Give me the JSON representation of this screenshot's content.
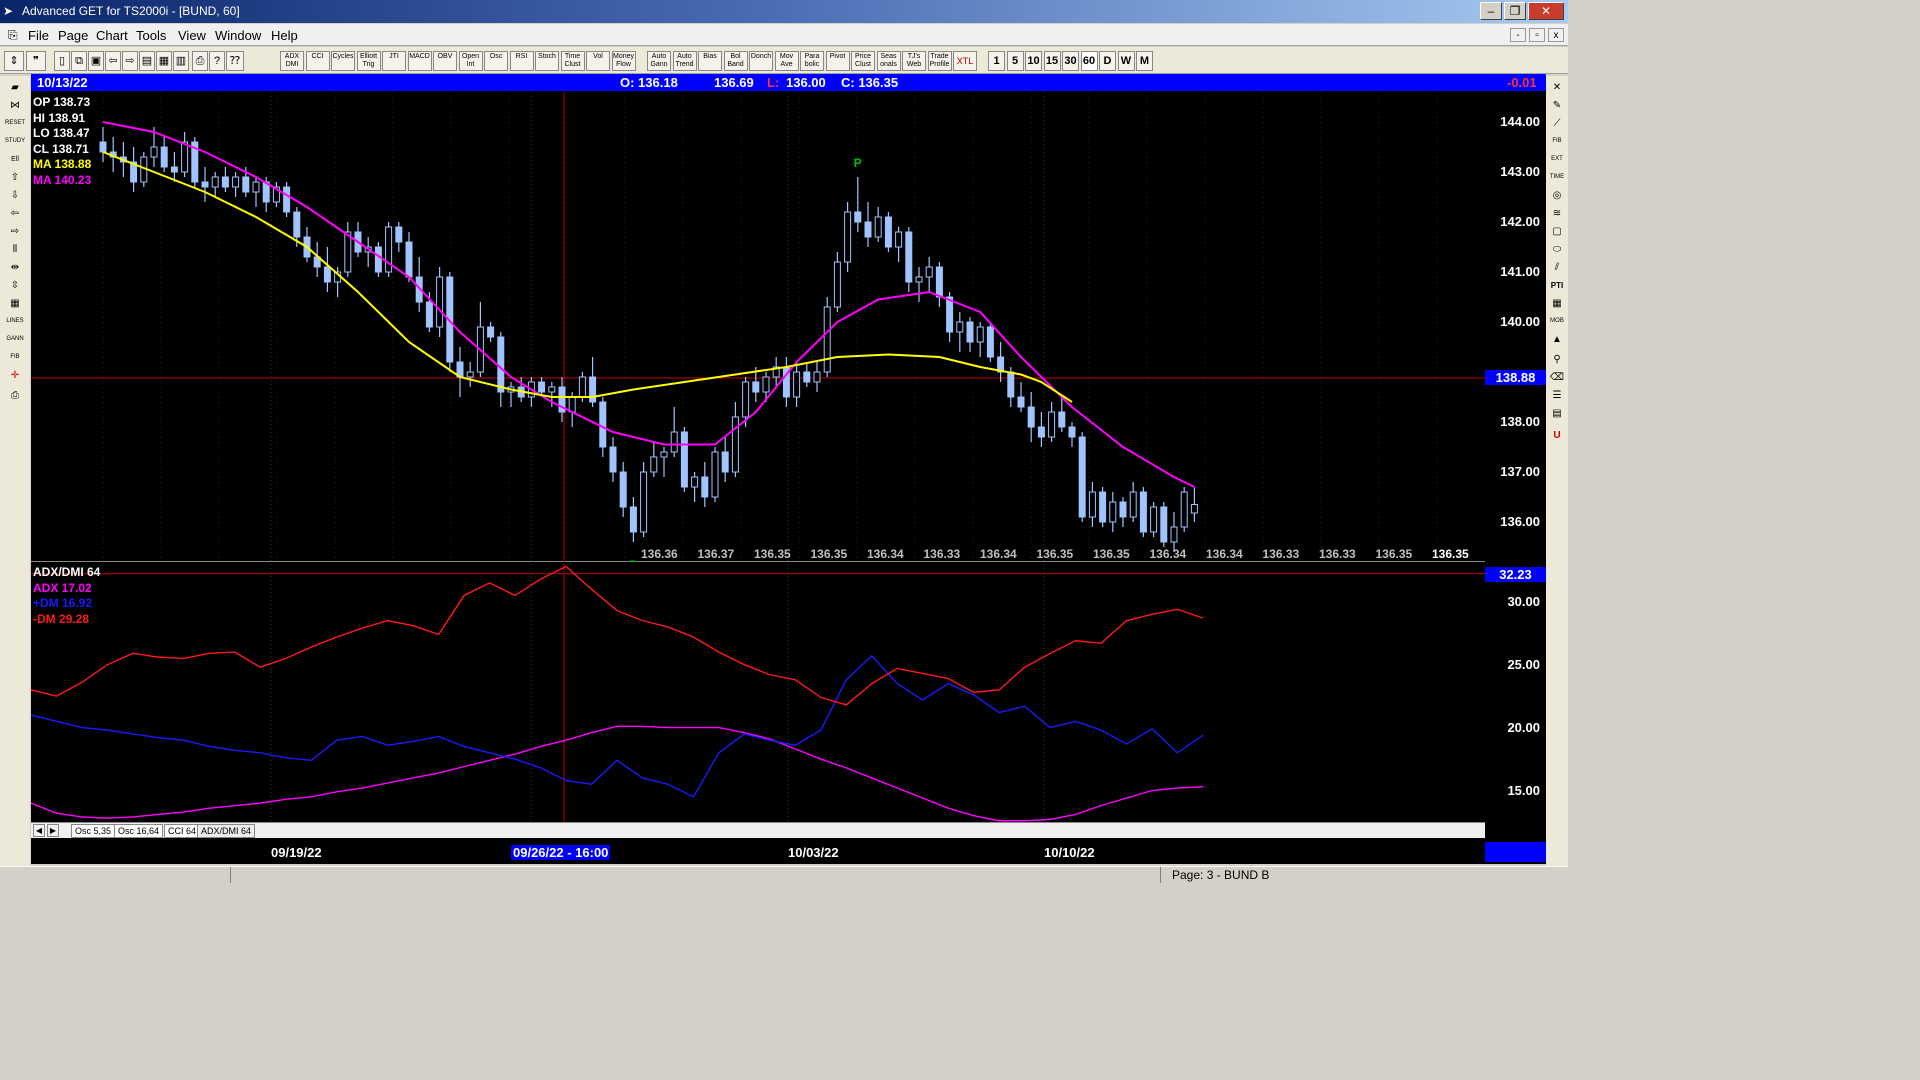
{
  "window": {
    "title": "Advanced GET for TS2000i - [BUND, 60]",
    "minimize": "‒",
    "maximize": "❐",
    "close": "✕"
  },
  "menu": [
    "File",
    "Page",
    "Chart",
    "Tools",
    "View",
    "Window",
    "Help"
  ],
  "mdi_buttons": [
    "-",
    "▫",
    "x"
  ],
  "toolbar": {
    "indicators": [
      "ADX DMI",
      "CCI",
      "Cycles",
      "Elliott Trig",
      "JTI",
      "MACD",
      "OBV",
      "Open Int",
      "Osc",
      "RSI",
      "Stoch",
      "Time Clust",
      "Vol",
      "Money Flow",
      "Auto Gann",
      "Auto Trend",
      "Bias",
      "Bol Band",
      "Donch",
      "Mov Ave",
      "Para bolic",
      "Pivot",
      "Price Clust",
      "Seas onals",
      "TJ's Web",
      "Trade Profile",
      "XTL"
    ],
    "periods": [
      "1",
      "5",
      "10",
      "15",
      "30",
      "60",
      "D",
      "W",
      "M"
    ],
    "selected_period": "60"
  },
  "info_bar": {
    "date": "10/13/22",
    "open": "O: 136.18",
    "high": "136.69",
    "low_label": "L:",
    "low": "136.00",
    "close": "C: 136.35",
    "change": "-0.01"
  },
  "price_labels": [
    {
      "text": "OP  138.73",
      "color": "#ffffff"
    },
    {
      "text": "HI   138.91",
      "color": "#ffffff"
    },
    {
      "text": "LO  138.47",
      "color": "#ffffff"
    },
    {
      "text": "CL  138.71",
      "color": "#ffffff"
    },
    {
      "text": "MA  138.88",
      "color": "#ffff00"
    },
    {
      "text": "MA  140.23",
      "color": "#ff00ff"
    }
  ],
  "osc_labels": [
    {
      "text": "ADX/DMI 64",
      "color": "#ffffff"
    },
    {
      "text": "ADX 17.02",
      "color": "#ff00ff"
    },
    {
      "text": "+DM 16.92",
      "color": "#1a1aff"
    },
    {
      "text": "-DM  29.28",
      "color": "#ff1a1a"
    }
  ],
  "price_axis_ticks": [
    "144.00",
    "143.00",
    "142.00",
    "141.00",
    "140.00",
    "138.00",
    "137.00",
    "136.00"
  ],
  "price_marker": "138.88",
  "osc_axis_ticks": [
    "30.00",
    "25.00",
    "20.00",
    "15.00"
  ],
  "osc_marker": "32.23",
  "bottom_values": [
    "136.36",
    "136.37",
    "136.35",
    "136.35",
    "136.34",
    "136.33",
    "136.34",
    "136.35",
    "136.35",
    "136.34",
    "136.34",
    "136.33",
    "136.33",
    "136.35",
    "136.35"
  ],
  "pivot_marks": [
    "P",
    "P"
  ],
  "tabs": [
    "Osc 5,35",
    "Osc 16,64",
    "CCI 64",
    "ADX/DMI 64"
  ],
  "active_tab": "ADX/DMI 64",
  "dates": [
    "09/19/22",
    "09/26/22 - 16:00",
    "10/03/22",
    "10/10/22"
  ],
  "status": "Page: 3 - BUND B",
  "colors": {
    "ma_fast": "#ffff00",
    "ma_slow": "#ff00ff",
    "adx": "#ff00ff",
    "plus_dm": "#1a1aff",
    "minus_dm": "#ff1a1a",
    "bars": "#a0c4ff",
    "crosshair": "#c00000"
  },
  "chart_data": [
    {
      "type": "candlestick",
      "title": "BUND, 60",
      "ylim": [
        135.2,
        144.6
      ],
      "ma_fast_path": [
        [
          0,
          143.4
        ],
        [
          5,
          143.0
        ],
        [
          10,
          142.6
        ],
        [
          15,
          142.1
        ],
        [
          20,
          141.5
        ],
        [
          25,
          140.6
        ],
        [
          30,
          139.6
        ],
        [
          35,
          138.9
        ],
        [
          40,
          138.65
        ],
        [
          44,
          138.5
        ],
        [
          48,
          138.5
        ],
        [
          52,
          138.65
        ],
        [
          57,
          138.8
        ],
        [
          62,
          138.95
        ],
        [
          67,
          139.1
        ],
        [
          72,
          139.3
        ],
        [
          77,
          139.35
        ],
        [
          82,
          139.3
        ],
        [
          86,
          139.1
        ],
        [
          90,
          138.95
        ],
        [
          92,
          138.8
        ],
        [
          95,
          138.4
        ]
      ],
      "ma_slow_path": [
        [
          0,
          144.0
        ],
        [
          5,
          143.8
        ],
        [
          10,
          143.4
        ],
        [
          15,
          142.9
        ],
        [
          20,
          142.3
        ],
        [
          25,
          141.6
        ],
        [
          30,
          140.9
        ],
        [
          35,
          139.8
        ],
        [
          40,
          138.9
        ],
        [
          44,
          138.4
        ],
        [
          50,
          137.8
        ],
        [
          55,
          137.55
        ],
        [
          60,
          137.55
        ],
        [
          64,
          138.2
        ],
        [
          68,
          139.2
        ],
        [
          72,
          140.0
        ],
        [
          76,
          140.45
        ],
        [
          81,
          140.6
        ],
        [
          86,
          140.2
        ],
        [
          90,
          139.3
        ],
        [
          95,
          138.3
        ],
        [
          100,
          137.5
        ],
        [
          105,
          136.9
        ],
        [
          107,
          136.7
        ]
      ],
      "ohlc": [
        [
          143.6,
          143.9,
          143.2,
          143.4
        ],
        [
          143.4,
          143.7,
          143.0,
          143.3
        ],
        [
          143.3,
          143.6,
          142.9,
          143.2
        ],
        [
          143.2,
          143.5,
          142.6,
          142.8
        ],
        [
          142.8,
          143.4,
          142.7,
          143.3
        ],
        [
          143.3,
          143.9,
          143.1,
          143.5
        ],
        [
          143.5,
          143.7,
          143.0,
          143.1
        ],
        [
          143.1,
          143.4,
          142.8,
          143.0
        ],
        [
          143.0,
          143.8,
          142.9,
          143.6
        ],
        [
          143.6,
          143.7,
          142.7,
          142.8
        ],
        [
          142.8,
          143.1,
          142.4,
          142.7
        ],
        [
          142.7,
          143.0,
          142.5,
          142.9
        ],
        [
          142.9,
          143.1,
          142.6,
          142.7
        ],
        [
          142.7,
          143.0,
          142.5,
          142.9
        ],
        [
          142.9,
          143.1,
          142.5,
          142.6
        ],
        [
          142.6,
          142.9,
          142.3,
          142.8
        ],
        [
          142.8,
          142.9,
          142.2,
          142.4
        ],
        [
          142.4,
          142.8,
          142.3,
          142.7
        ],
        [
          142.7,
          142.8,
          142.1,
          142.2
        ],
        [
          142.2,
          142.3,
          141.5,
          141.7
        ],
        [
          141.7,
          141.9,
          141.2,
          141.3
        ],
        [
          141.3,
          141.6,
          140.9,
          141.1
        ],
        [
          141.1,
          141.5,
          140.6,
          140.8
        ],
        [
          140.8,
          141.1,
          140.5,
          141.0
        ],
        [
          141.0,
          142.0,
          140.9,
          141.8
        ],
        [
          141.8,
          142.0,
          141.3,
          141.4
        ],
        [
          141.4,
          141.7,
          141.1,
          141.5
        ],
        [
          141.5,
          141.6,
          140.9,
          141.0
        ],
        [
          141.0,
          142.0,
          140.9,
          141.9
        ],
        [
          141.9,
          142.0,
          141.4,
          141.6
        ],
        [
          141.6,
          141.8,
          140.8,
          140.9
        ],
        [
          140.9,
          141.3,
          140.2,
          140.4
        ],
        [
          140.4,
          140.6,
          139.8,
          139.9
        ],
        [
          139.9,
          141.1,
          139.7,
          140.9
        ],
        [
          140.9,
          141.0,
          139.0,
          139.2
        ],
        [
          139.2,
          139.5,
          138.5,
          138.9
        ],
        [
          138.9,
          139.2,
          138.7,
          139.0
        ],
        [
          139.0,
          140.4,
          138.9,
          139.9
        ],
        [
          139.9,
          140.0,
          139.6,
          139.7
        ],
        [
          139.7,
          139.8,
          138.3,
          138.6
        ],
        [
          138.6,
          138.8,
          138.3,
          138.7
        ],
        [
          138.7,
          138.9,
          138.4,
          138.5
        ],
        [
          138.5,
          138.9,
          138.3,
          138.8
        ],
        [
          138.8,
          138.9,
          138.5,
          138.6
        ],
        [
          138.6,
          138.8,
          138.3,
          138.7
        ],
        [
          138.7,
          138.9,
          138.0,
          138.2
        ],
        [
          138.2,
          138.6,
          137.9,
          138.5
        ],
        [
          138.5,
          139.0,
          138.4,
          138.9
        ],
        [
          138.9,
          139.3,
          138.3,
          138.4
        ],
        [
          138.4,
          138.5,
          137.3,
          137.5
        ],
        [
          137.5,
          137.7,
          136.8,
          137.0
        ],
        [
          137.0,
          137.2,
          136.1,
          136.3
        ],
        [
          136.3,
          136.5,
          135.6,
          135.8
        ],
        [
          135.8,
          137.2,
          135.7,
          137.0
        ],
        [
          137.0,
          137.6,
          136.9,
          137.3
        ],
        [
          137.3,
          137.5,
          136.9,
          137.4
        ],
        [
          137.4,
          138.3,
          137.3,
          137.8
        ],
        [
          137.8,
          137.9,
          136.6,
          136.7
        ],
        [
          136.7,
          137.0,
          136.4,
          136.9
        ],
        [
          136.9,
          137.2,
          136.3,
          136.5
        ],
        [
          136.5,
          137.5,
          136.4,
          137.4
        ],
        [
          137.4,
          137.7,
          136.8,
          137.0
        ],
        [
          137.0,
          138.4,
          136.9,
          138.1
        ],
        [
          138.1,
          138.9,
          137.9,
          138.8
        ],
        [
          138.8,
          139.1,
          138.4,
          138.6
        ],
        [
          138.6,
          139.0,
          138.4,
          138.9
        ],
        [
          138.9,
          139.3,
          138.7,
          139.1
        ],
        [
          139.1,
          139.3,
          138.3,
          138.5
        ],
        [
          138.5,
          139.2,
          138.3,
          139.0
        ],
        [
          139.0,
          139.2,
          138.7,
          138.8
        ],
        [
          138.8,
          139.2,
          138.6,
          139.0
        ],
        [
          139.0,
          140.5,
          138.9,
          140.3
        ],
        [
          140.3,
          141.4,
          140.2,
          141.2
        ],
        [
          141.2,
          142.4,
          141.0,
          142.2
        ],
        [
          142.2,
          142.9,
          141.8,
          142.0
        ],
        [
          142.0,
          142.4,
          141.5,
          141.7
        ],
        [
          141.7,
          142.3,
          141.6,
          142.1
        ],
        [
          142.1,
          142.2,
          141.4,
          141.5
        ],
        [
          141.5,
          141.9,
          141.2,
          141.8
        ],
        [
          141.8,
          141.9,
          140.6,
          140.8
        ],
        [
          140.8,
          141.1,
          140.4,
          140.9
        ],
        [
          140.9,
          141.3,
          140.6,
          141.1
        ],
        [
          141.1,
          141.2,
          140.3,
          140.5
        ],
        [
          140.5,
          140.6,
          139.6,
          139.8
        ],
        [
          139.8,
          140.2,
          139.4,
          140.0
        ],
        [
          140.0,
          140.1,
          139.4,
          139.6
        ],
        [
          139.6,
          140.0,
          139.3,
          139.9
        ],
        [
          139.9,
          140.0,
          139.2,
          139.3
        ],
        [
          139.3,
          139.6,
          138.8,
          139.0
        ],
        [
          139.0,
          139.1,
          138.3,
          138.5
        ],
        [
          138.5,
          138.8,
          138.2,
          138.3
        ],
        [
          138.3,
          138.6,
          137.6,
          137.9
        ],
        [
          137.9,
          138.2,
          137.5,
          137.7
        ],
        [
          137.7,
          138.4,
          137.6,
          138.2
        ],
        [
          138.2,
          138.5,
          137.8,
          137.9
        ],
        [
          137.9,
          138.0,
          137.5,
          137.7
        ],
        [
          137.7,
          137.8,
          136.0,
          136.1
        ],
        [
          136.1,
          136.8,
          135.9,
          136.6
        ],
        [
          136.6,
          136.7,
          135.9,
          136.0
        ],
        [
          136.0,
          136.6,
          135.8,
          136.4
        ],
        [
          136.4,
          136.5,
          135.9,
          136.1
        ],
        [
          136.1,
          136.8,
          136.0,
          136.6
        ],
        [
          136.6,
          136.7,
          135.7,
          135.8
        ],
        [
          135.8,
          136.4,
          135.7,
          136.3
        ],
        [
          136.3,
          136.4,
          135.5,
          135.6
        ],
        [
          135.6,
          136.2,
          135.4,
          135.9
        ],
        [
          135.9,
          136.7,
          135.8,
          136.6
        ],
        [
          136.18,
          136.69,
          136.0,
          136.35
        ]
      ],
      "series": [
        {
          "name": "MA",
          "last": 138.88
        },
        {
          "name": "MA",
          "last": 140.23
        }
      ]
    },
    {
      "type": "line",
      "title": "ADX/DMI 64",
      "ylim": [
        12.5,
        33.0
      ],
      "series": [
        {
          "name": "ADX",
          "values": [
            14.0,
            13.2,
            12.9,
            12.8,
            12.9,
            13.1,
            13.3,
            13.6,
            13.8,
            14.0,
            14.3,
            14.5,
            14.9,
            15.2,
            15.6,
            16.0,
            16.4,
            16.9,
            17.4,
            17.9,
            18.5,
            19.0,
            19.6,
            20.1,
            20.1,
            20.0,
            20.0,
            20.0,
            19.6,
            19.1,
            18.3,
            17.5,
            16.8,
            16.0,
            15.2,
            14.4,
            13.6,
            13.0,
            12.6,
            12.6,
            12.7,
            13.1,
            13.8,
            14.4,
            15.0,
            15.2,
            15.3
          ]
        },
        {
          "name": "+DM",
          "values": [
            21.0,
            20.5,
            20.0,
            19.8,
            19.5,
            19.2,
            19.0,
            18.5,
            18.2,
            18.0,
            17.6,
            17.4,
            19.0,
            19.3,
            18.6,
            18.9,
            19.3,
            18.5,
            18.0,
            17.5,
            16.8,
            15.8,
            15.5,
            17.4,
            16.0,
            15.5,
            14.5,
            18.0,
            19.5,
            19.0,
            18.6,
            19.8,
            23.8,
            25.7,
            23.5,
            22.2,
            23.5,
            22.6,
            21.2,
            21.7,
            20.0,
            20.5,
            19.8,
            18.7,
            19.9,
            18.0,
            19.4
          ]
        },
        {
          "name": "-DM",
          "values": [
            23.0,
            22.5,
            23.6,
            25.0,
            25.9,
            25.6,
            25.5,
            25.9,
            26.0,
            24.8,
            25.5,
            26.4,
            27.2,
            27.9,
            28.5,
            28.1,
            27.4,
            30.5,
            31.5,
            30.5,
            31.8,
            32.8,
            31.0,
            29.3,
            28.5,
            28.0,
            27.2,
            26.0,
            25.0,
            24.2,
            23.8,
            22.4,
            21.8,
            23.5,
            24.7,
            24.3,
            23.9,
            22.8,
            23.0,
            24.8,
            25.9,
            26.9,
            26.7,
            28.5,
            29.0,
            29.4,
            28.7
          ]
        }
      ]
    }
  ]
}
